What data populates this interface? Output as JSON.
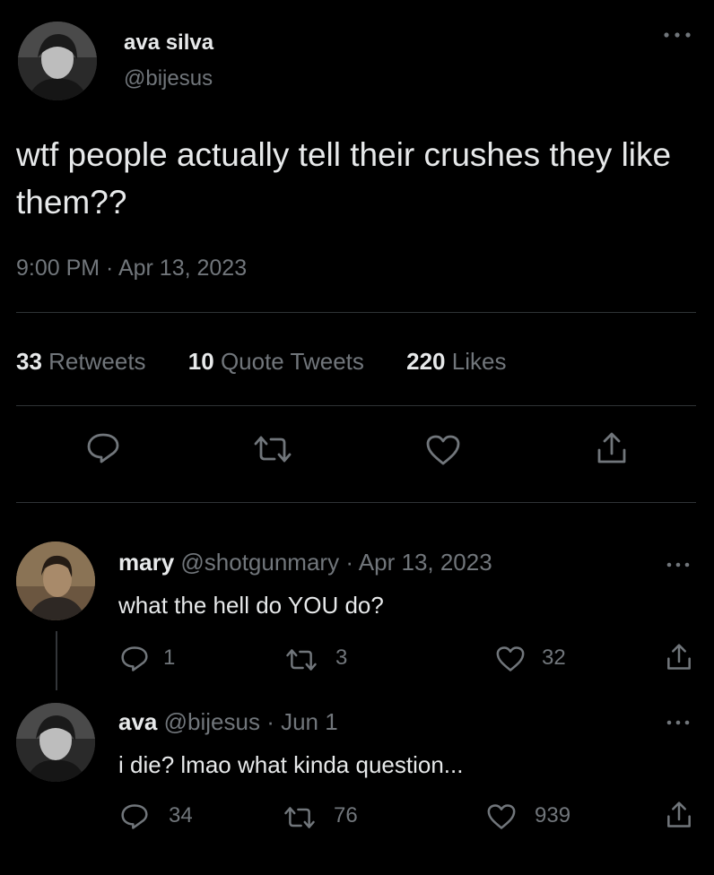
{
  "main_tweet": {
    "display_name": "ava silva",
    "handle": "@bijesus",
    "text": "wtf people actually tell their crushes they like them??",
    "timestamp": "9:00 PM · Apr 13, 2023",
    "stats": {
      "retweets_count": "33",
      "retweets_label": "Retweets",
      "quotes_count": "10",
      "quotes_label": "Quote Tweets",
      "likes_count": "220",
      "likes_label": "Likes"
    },
    "more_icon": "…"
  },
  "replies": [
    {
      "display_name": "mary",
      "handle": "@shotgunmary",
      "separator": "·",
      "date": "Apr 13, 2023",
      "text": "what the hell do YOU do?",
      "reply_count": "1",
      "retweet_count": "3",
      "like_count": "32"
    },
    {
      "display_name": "ava",
      "handle": "@bijesus",
      "separator": "·",
      "date": "Jun 1",
      "text": "i die? lmao what kinda question...",
      "reply_count": "34",
      "retweet_count": "76",
      "like_count": "939"
    }
  ],
  "icons": {
    "reply": "reply-icon",
    "retweet": "retweet-icon",
    "like": "heart-icon",
    "share": "share-icon",
    "more": "more-icon"
  },
  "colors": {
    "background": "#000000",
    "text": "#e7e9ea",
    "muted": "#71767b",
    "divider": "#2f3336"
  }
}
